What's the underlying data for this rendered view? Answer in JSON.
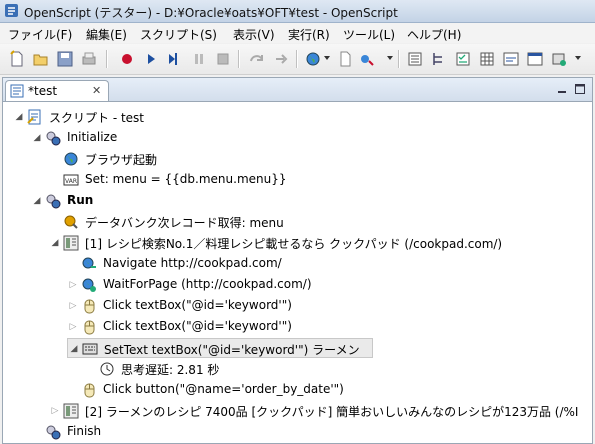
{
  "window": {
    "title": "OpenScript (テスター) - D:¥Oracle¥oats¥OFT¥test - OpenScript"
  },
  "menu": [
    {
      "label": "ファイル(F)"
    },
    {
      "label": "編集(E)"
    },
    {
      "label": "スクリプト(S)"
    },
    {
      "label": "表示(V)"
    },
    {
      "label": "実行(R)"
    },
    {
      "label": "ツール(L)"
    },
    {
      "label": "ヘルプ(H)"
    }
  ],
  "editor": {
    "tab_label": "*test",
    "tab_close": "✕"
  },
  "tree": [
    {
      "label": "スクリプト - test",
      "icon": "script-icon"
    },
    {
      "label": "Initialize",
      "icon": "section-icon"
    },
    {
      "label": "ブラウザ起動",
      "icon": "globe-icon"
    },
    {
      "label": "Set: menu = {{db.menu.menu}}",
      "icon": "var-icon"
    },
    {
      "label": "Run",
      "icon": "section-icon"
    },
    {
      "label": "データバンク次レコード取得: menu",
      "icon": "databank-icon"
    },
    {
      "label": "[1] レシピ検索No.1／料理レシピ載せるなら クックパッド (/cookpad.com/)",
      "icon": "page-icon"
    },
    {
      "label": "Navigate http://cookpad.com/",
      "icon": "navigate-icon"
    },
    {
      "label": "WaitForPage (http://cookpad.com/)",
      "icon": "wait-icon"
    },
    {
      "label": "Click textBox(\"@id='keyword'\")",
      "icon": "click-icon"
    },
    {
      "label": "Click textBox(\"@id='keyword'\")",
      "icon": "click-icon"
    },
    {
      "label": "SetText textBox(\"@id='keyword'\") ラーメン",
      "icon": "keyboard-icon"
    },
    {
      "label": "思考遅延: 2.81 秒",
      "icon": "clock-icon"
    },
    {
      "label": "Click button(\"@name='order_by_date'\")",
      "icon": "click-icon"
    },
    {
      "label": "[2] ラーメンのレシピ 7400品 [クックパッド] 簡単おいしいみんなのレシピが123万品 (/%I",
      "icon": "page-icon"
    },
    {
      "label": "Finish",
      "icon": "section-icon"
    }
  ]
}
